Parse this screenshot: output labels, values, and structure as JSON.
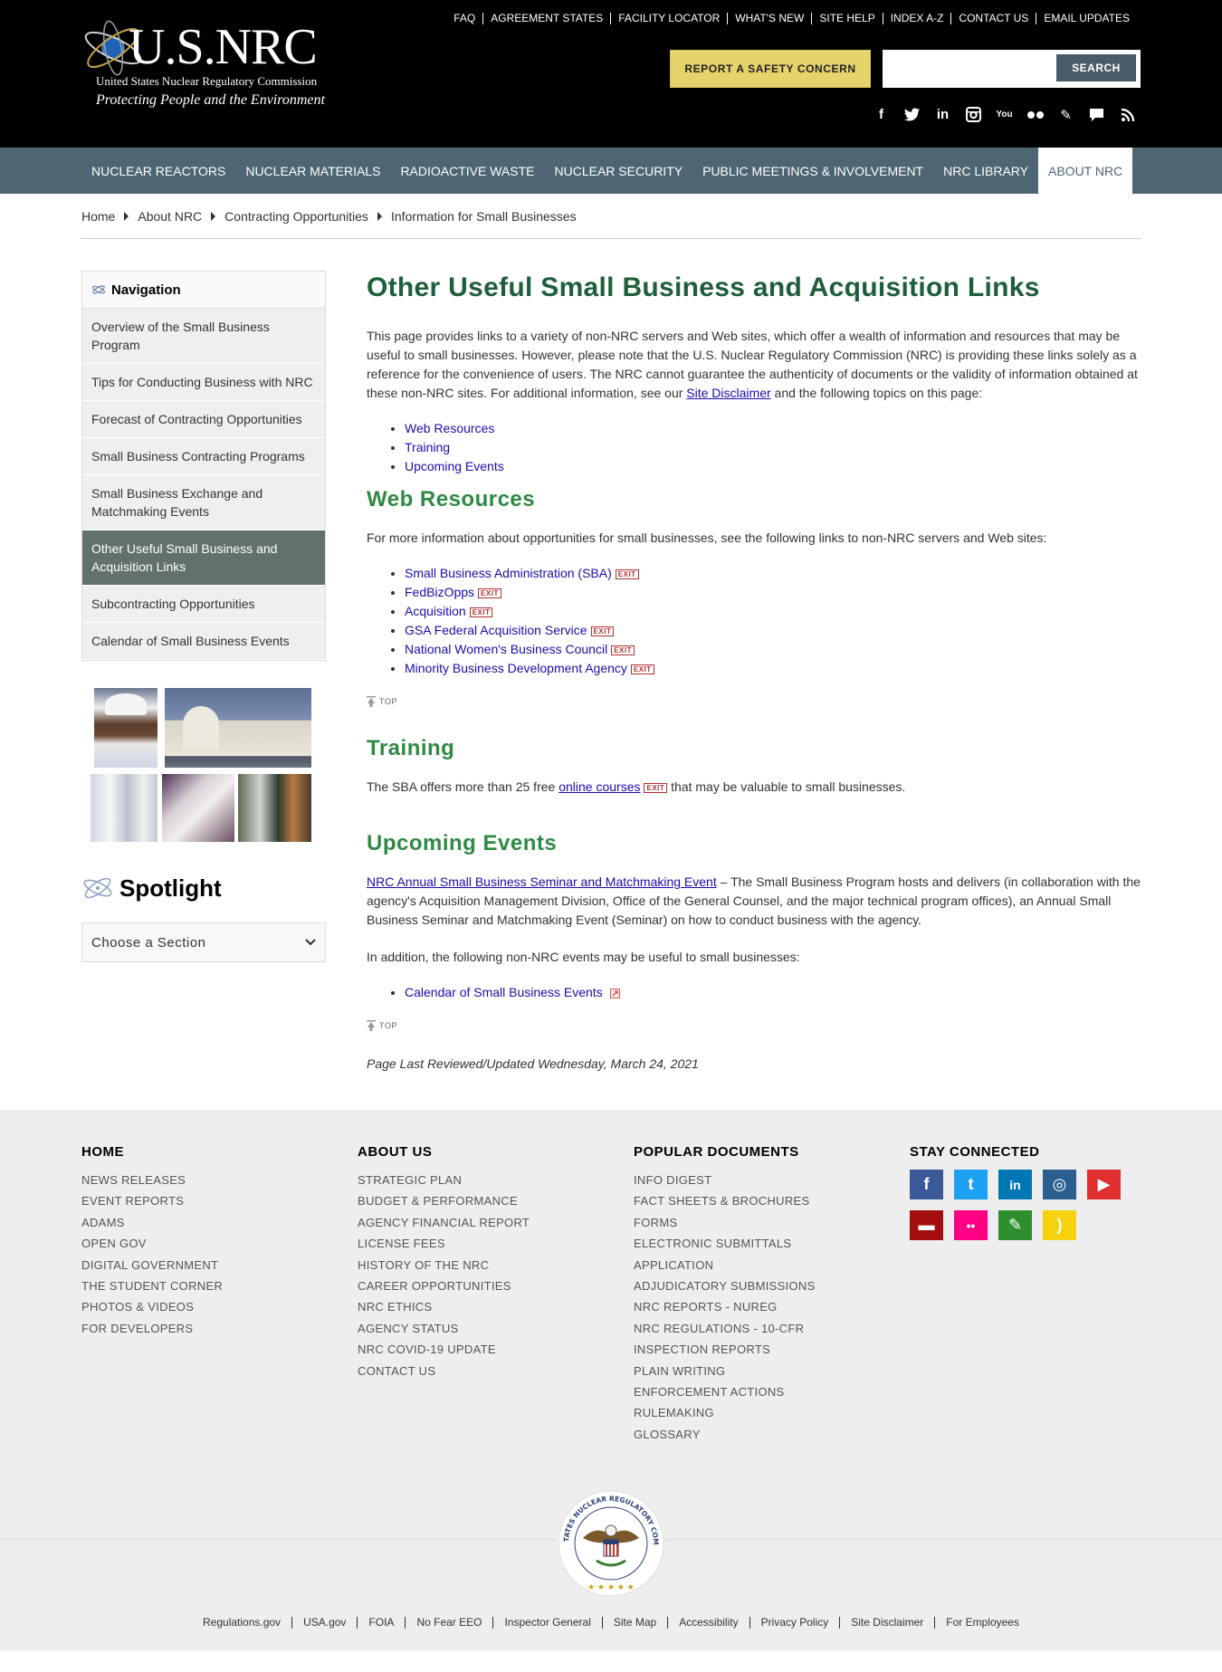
{
  "header": {
    "logo_title": "U.S.NRC",
    "logo_subtitle": "United States Nuclear Regulatory Commission",
    "logo_tagline": "Protecting People and the Environment",
    "util_links": [
      "FAQ",
      "AGREEMENT STATES",
      "FACILITY LOCATOR",
      "WHAT'S NEW",
      "SITE HELP",
      "INDEX A-Z",
      "CONTACT US",
      "EMAIL UPDATES"
    ],
    "report_button": "REPORT A SAFETY CONCERN",
    "search_placeholder": "",
    "search_button": "SEARCH",
    "social_icons": [
      "facebook-icon",
      "twitter-icon",
      "linkedin-icon",
      "instagram-icon",
      "youtube-icon",
      "flickr-icon",
      "blog-icon",
      "comment-icon",
      "rss-icon"
    ]
  },
  "mainnav": {
    "items": [
      "NUCLEAR REACTORS",
      "NUCLEAR MATERIALS",
      "RADIOACTIVE WASTE",
      "NUCLEAR SECURITY",
      "PUBLIC MEETINGS & INVOLVEMENT",
      "NRC LIBRARY",
      "ABOUT NRC"
    ],
    "active": "ABOUT NRC"
  },
  "breadcrumb": [
    "Home",
    "About NRC",
    "Contracting Opportunities",
    "Information for Small Businesses"
  ],
  "sidebar": {
    "nav_title": "Navigation",
    "items": [
      "Overview of the Small Business Program",
      "Tips for Conducting Business with NRC",
      "Forecast of Contracting Opportunities",
      "Small Business Contracting Programs",
      "Small Business Exchange and Matchmaking Events",
      "Other Useful Small Business and Acquisition Links",
      "Subcontracting Opportunities",
      "Calendar of Small Business Events"
    ],
    "active_index": 5,
    "spotlight_title": "Spotlight",
    "choose_section": "Choose a Section"
  },
  "main": {
    "title": "Other Useful Small Business and Acquisition Links",
    "intro_before": "This page provides links to a variety of non-NRC servers and Web sites, which offer a wealth of information and resources that may be useful to small businesses. However, please note that the U.S. Nuclear Regulatory Commission (NRC) is providing these links solely as a reference for the convenience of users. The NRC cannot guarantee the authenticity of documents or the validity of information obtained at these non-NRC sites. For additional information, see our",
    "intro_link": "Site Disclaimer",
    "intro_after": "and the following topics on this page:",
    "toc": [
      "Web Resources",
      "Training",
      "Upcoming Events"
    ],
    "web_resources": {
      "heading": "Web Resources",
      "text": "For more information about opportunities for small businesses, see the following links to non-NRC servers and Web sites:",
      "links": [
        "Small Business Administration (SBA)",
        "FedBizOpps",
        "Acquisition",
        "GSA Federal Acquisition Service",
        "National Women's Business Council",
        "Minority Business Development Agency"
      ]
    },
    "exit_label": "EXIT",
    "top_label": "TOP",
    "training": {
      "heading": "Training",
      "before": "The SBA offers more than 25 free",
      "link": "online courses",
      "after": "that may be valuable to small businesses."
    },
    "events": {
      "heading": "Upcoming Events",
      "seminar_link": "NRC Annual Small Business Seminar and Matchmaking Event",
      "seminar_text": "– The Small Business Program hosts and delivers (in collaboration with the agency's Acquisition Management Division, Office of the General Counsel, and the major technical program offices), an Annual Small Business Seminar and Matchmaking Event (Seminar) on how to conduct business with the agency.",
      "addition": "In addition, the following non-NRC events may be useful to small businesses:",
      "links": [
        "Calendar of Small Business Events"
      ]
    },
    "reviewed": "Page Last Reviewed/Updated Wednesday, March 24, 2021"
  },
  "footer": {
    "columns": [
      {
        "title": "HOME",
        "links": [
          "NEWS RELEASES",
          "EVENT REPORTS",
          "ADAMS",
          "OPEN GOV",
          "DIGITAL GOVERNMENT",
          "THE STUDENT CORNER",
          "PHOTOS & VIDEOS",
          "FOR DEVELOPERS"
        ]
      },
      {
        "title": "ABOUT US",
        "links": [
          "STRATEGIC PLAN",
          "BUDGET & PERFORMANCE",
          "AGENCY FINANCIAL REPORT",
          "LICENSE FEES",
          "HISTORY OF THE NRC",
          "CAREER OPPORTUNITIES",
          "NRC ETHICS",
          "AGENCY STATUS",
          "NRC COVID-19 UPDATE",
          "CONTACT US"
        ]
      },
      {
        "title": "POPULAR DOCUMENTS",
        "links": [
          "INFO DIGEST",
          "FACT SHEETS & BROCHURES",
          "FORMS",
          "ELECTRONIC SUBMITTALS",
          "APPLICATION",
          "ADJUDICATORY SUBMISSIONS",
          "NRC REPORTS - NUREG",
          "NRC REGULATIONS - 10-CFR",
          "INSPECTION REPORTS",
          "PLAIN WRITING",
          "ENFORCEMENT ACTIONS",
          "RULEMAKING",
          "GLOSSARY"
        ]
      }
    ],
    "stay_connected": "STAY CONNECTED",
    "social": [
      {
        "name": "facebook-icon",
        "color": "#3b5998",
        "glyph": "f"
      },
      {
        "name": "twitter-icon",
        "color": "#1da1f2",
        "glyph": "t"
      },
      {
        "name": "linkedin-icon",
        "color": "#0077b5",
        "glyph": "in"
      },
      {
        "name": "instagram-icon",
        "color": "#2a5f8f",
        "glyph": "◎"
      },
      {
        "name": "youtube-icon",
        "color": "#e02f2f",
        "glyph": "▶"
      },
      {
        "name": "comment-icon",
        "color": "#a30f0f",
        "glyph": "▬"
      },
      {
        "name": "flickr-icon",
        "color": "#ff0084",
        "glyph": "••"
      },
      {
        "name": "blog-icon",
        "color": "#2f8f2f",
        "glyph": "✎"
      },
      {
        "name": "rss-icon",
        "color": "#f5d10f",
        "glyph": ")"
      }
    ],
    "seal_text": "UNITED STATES NUCLEAR REGULATORY COMMISSION",
    "bottom_links": [
      "Regulations.gov",
      "USA.gov",
      "FOIA",
      "No Fear EEO",
      "Inspector General",
      "Site Map",
      "Accessibility",
      "Privacy Policy",
      "Site Disclaimer",
      "For Employees"
    ]
  }
}
